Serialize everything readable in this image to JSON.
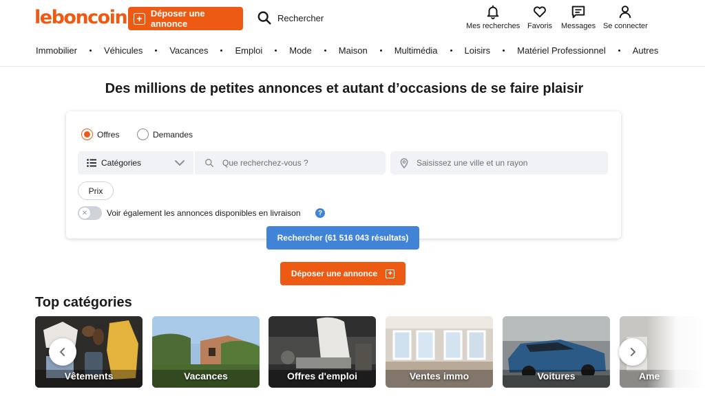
{
  "header": {
    "logo": "leboncoin",
    "post_button": "Déposer une annonce",
    "search_link": "Rechercher",
    "icons": [
      {
        "label": "Mes recherches",
        "icon": "bell-icon"
      },
      {
        "label": "Favoris",
        "icon": "heart-icon"
      },
      {
        "label": "Messages",
        "icon": "message-icon"
      },
      {
        "label": "Se connecter",
        "icon": "user-icon"
      }
    ]
  },
  "nav": {
    "items": [
      "Immobilier",
      "Véhicules",
      "Vacances",
      "Emploi",
      "Mode",
      "Maison",
      "Multimédia",
      "Loisirs",
      "Matériel Professionnel",
      "Autres"
    ]
  },
  "hero": {
    "title": "Des millions de petites annonces et autant d’occasions de se faire plaisir"
  },
  "search": {
    "radio_offres": "Offres",
    "radio_demandes": "Demandes",
    "selected": "Offres",
    "category_label": "Catégories",
    "query_placeholder": "Que recherchez-vous ?",
    "location_placeholder": "Saisissez une ville et un rayon",
    "price_filter": "Prix",
    "delivery_toggle_label": "Voir également les annonces disponibles en livraison",
    "delivery_toggle_on": false,
    "help_glyph": "?",
    "submit_label": "Rechercher (61 516 043 résultats)"
  },
  "post_button_secondary": "Déposer une annonce",
  "top_categories": {
    "title": "Top catégories",
    "items": [
      "Vêtements",
      "Vacances",
      "Offres d'emploi",
      "Ventes immo",
      "Voitures",
      "Ame"
    ]
  },
  "colors": {
    "brand_orange": "#ec5a13",
    "search_blue": "#4183d7",
    "field_bg": "#f0f2f5"
  }
}
